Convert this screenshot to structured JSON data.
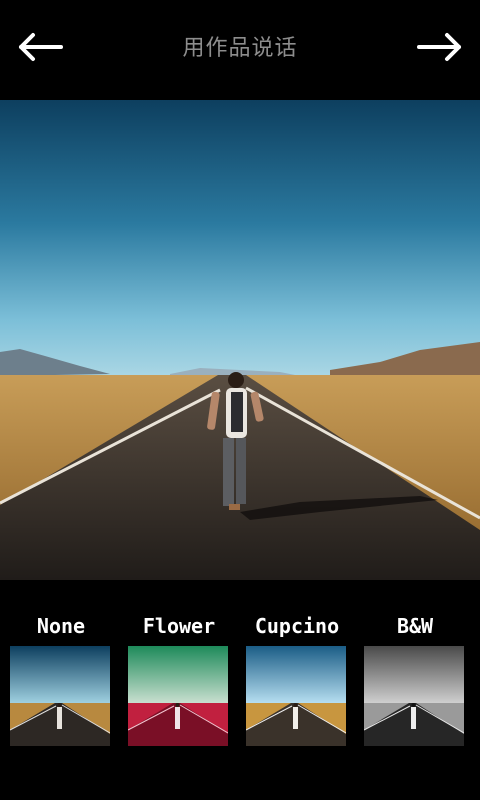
{
  "header": {
    "title": "用作品说话",
    "back_icon": "arrow-left-icon",
    "next_icon": "arrow-right-icon"
  },
  "main_image": {
    "icon": "photo"
  },
  "filters": [
    {
      "label": "None"
    },
    {
      "label": "Flower"
    },
    {
      "label": "Cupcino"
    },
    {
      "label": "B&W"
    }
  ],
  "colors": {
    "background": "#000000",
    "title": "#8d8d8d",
    "sky_top": "#0d3f5f",
    "sky_horizon": "#8ec7dd",
    "ground": "#b8893f",
    "road": "#2a2622"
  }
}
